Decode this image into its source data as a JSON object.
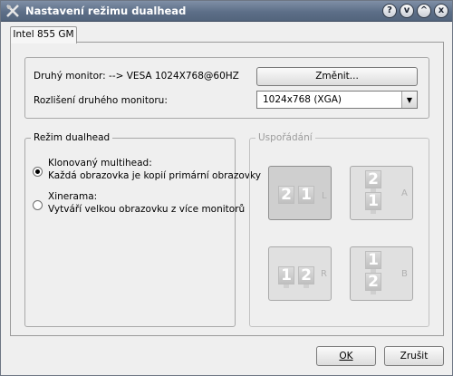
{
  "window": {
    "title": "Nastavení režimu dualhead",
    "buttons": {
      "help": "?",
      "minimize": "v",
      "maximize": "^",
      "close": "x"
    }
  },
  "tabs": [
    "Intel 855 GM"
  ],
  "monitor": {
    "second_monitor_label": "Druhý monitor: --> VESA 1024X768@60HZ",
    "change_button": "Změnit...",
    "resolution_label": "Rozlišení druhého monitoru:",
    "resolution_value": "1024x768 (XGA)"
  },
  "mode": {
    "title": "Režim dualhead",
    "options": [
      {
        "line1": "Klonovaný multihead:",
        "line2": "Každá obrazovka je kopií primární obrazovky",
        "selected": true
      },
      {
        "line1": "Xinerama:",
        "line2": "Vytváří velkou obrazovku z více monitorů",
        "selected": false
      }
    ]
  },
  "arrangement": {
    "title": "Uspořádání",
    "options": [
      {
        "letter": "L",
        "top": "2",
        "bottom": "1",
        "selected": true
      },
      {
        "letter": "A",
        "top": "2",
        "bottom": "1",
        "selected": false
      },
      {
        "letter": "R",
        "top": "1",
        "bottom": "2",
        "selected": false
      },
      {
        "letter": "B",
        "top": "1",
        "bottom": "2",
        "selected": false
      }
    ]
  },
  "footer": {
    "ok": "OK",
    "cancel": "Zrušit"
  }
}
